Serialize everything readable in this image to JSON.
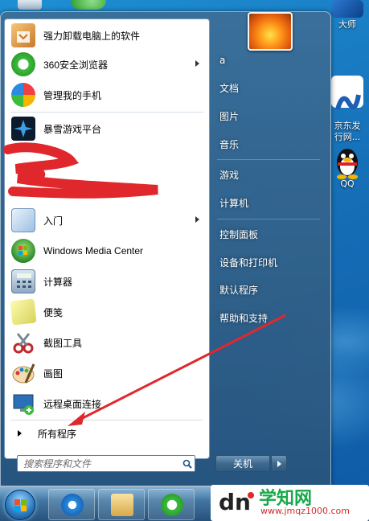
{
  "desktop": {
    "icons": [
      {
        "label": "大师",
        "name": "desktop-icon-master"
      },
      {
        "label": "京东发\n行网...",
        "name": "desktop-icon-jd"
      },
      {
        "label": "QQ",
        "name": "desktop-icon-qq"
      }
    ]
  },
  "start_menu": {
    "pinned_items": [
      {
        "label": "强力卸载电脑上的软件",
        "icon": "uninstall-icon",
        "has_submenu": false
      },
      {
        "label": "360安全浏览器",
        "icon": "360-browser-icon",
        "has_submenu": true
      },
      {
        "label": "管理我的手机",
        "icon": "phone-manager-icon",
        "has_submenu": false
      }
    ],
    "recent_items": [
      {
        "label": "暴雪游戏平台",
        "icon": "battlenet-icon",
        "has_submenu": false
      },
      {
        "label": "入门",
        "icon": "getting-started-icon",
        "has_submenu": true
      },
      {
        "label": "Windows Media Center",
        "icon": "media-center-icon",
        "has_submenu": false
      },
      {
        "label": "计算器",
        "icon": "calculator-icon",
        "has_submenu": false
      },
      {
        "label": "便笺",
        "icon": "sticky-notes-icon",
        "has_submenu": false
      },
      {
        "label": "截图工具",
        "icon": "snipping-tool-icon",
        "has_submenu": false
      },
      {
        "label": "画图",
        "icon": "paint-icon",
        "has_submenu": false
      },
      {
        "label": "远程桌面连接",
        "icon": "remote-desktop-icon",
        "has_submenu": false
      }
    ],
    "all_programs_label": "所有程序",
    "search_placeholder": "搜索程序和文件",
    "right_items": [
      {
        "label": "a",
        "name": "right-item-user"
      },
      {
        "label": "文档",
        "name": "right-item-documents"
      },
      {
        "label": "图片",
        "name": "right-item-pictures"
      },
      {
        "label": "音乐",
        "name": "right-item-music"
      },
      {
        "label": "游戏",
        "name": "right-item-games"
      },
      {
        "label": "计算机",
        "name": "right-item-computer"
      },
      {
        "label": "控制面板",
        "name": "right-item-control-panel"
      },
      {
        "label": "设备和打印机",
        "name": "right-item-devices-printers"
      },
      {
        "label": "默认程序",
        "name": "right-item-default-programs"
      },
      {
        "label": "帮助和支持",
        "name": "right-item-help-support"
      }
    ],
    "shutdown_label": "关机"
  },
  "watermark": {
    "main_text": "学知网",
    "sub_text": "www.jmqz1000.com"
  },
  "colors": {
    "annotation_red": "#e0282c",
    "desktop_blue": "#1670b8"
  }
}
